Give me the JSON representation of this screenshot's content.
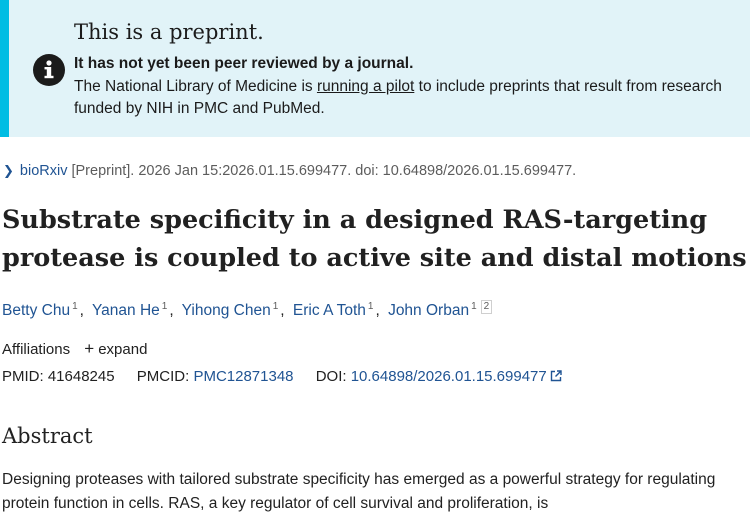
{
  "banner": {
    "heading": "This is a preprint.",
    "strong": "It has not yet been peer reviewed by a journal.",
    "text_before": "The National Library of Medicine is ",
    "link": "running a pilot",
    "text_after": " to include preprints that result from research funded by NIH in PMC and PubMed.",
    "icon": "info-icon"
  },
  "source": {
    "journal": "bioRxiv",
    "rest": " [Preprint]. 2026 Jan 15:2026.01.15.699477. doi: 10.64898/2026.01.15.699477."
  },
  "title": "Substrate specificity in a designed RAS-targeting protease is coupled to active site and distal motions",
  "authors": [
    {
      "name": "Betty Chu",
      "sup": "1"
    },
    {
      "name": "Yanan He",
      "sup": "1"
    },
    {
      "name": "Yihong Chen",
      "sup": "1"
    },
    {
      "name": "Eric A Toth",
      "sup": "1"
    },
    {
      "name": "John Orban",
      "sup": "1",
      "sup2": "2"
    }
  ],
  "affiliations": {
    "label": "Affiliations",
    "expand": "expand"
  },
  "ids": {
    "pmid_label": "PMID:",
    "pmid": "41648245",
    "pmcid_label": "PMCID:",
    "pmcid": "PMC12871348",
    "doi_label": "DOI:",
    "doi": "10.64898/2026.01.15.699477"
  },
  "abstract": {
    "heading": "Abstract",
    "text": "Designing proteases with tailored substrate specificity has emerged as a powerful strategy for regulating protein function in cells. RAS, a key regulator of cell survival and proliferation, is"
  }
}
